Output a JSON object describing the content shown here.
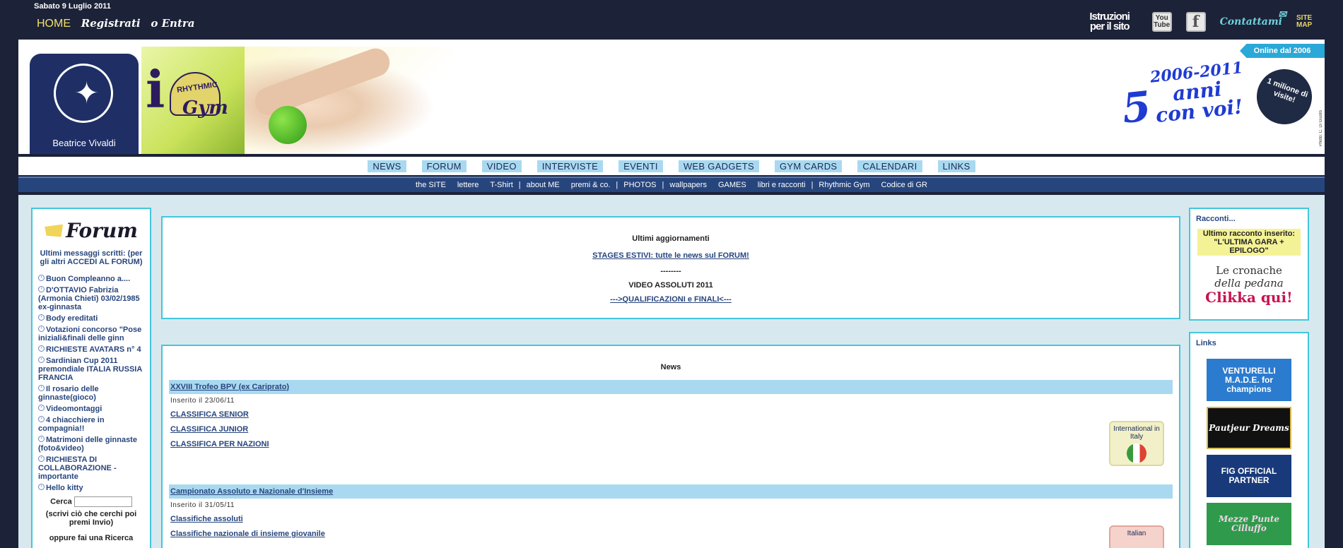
{
  "topbar": {
    "date": "Sabato 9 Luglio 2011",
    "home": "HOME",
    "register": "Registrati",
    "or_enter": "o Entra",
    "instructions": "Istruzioni per il sito",
    "youtube": "You Tube",
    "facebook": "f",
    "contact": "Contattami",
    "sitemap": "SITE MAP"
  },
  "banner": {
    "name": "Beatrice Vivaldi",
    "brand_rhythmic": "RHYTHMIC",
    "brand_gym": "Gym",
    "online_since": "Online dal 2006",
    "years": "2006-2011",
    "five": "5",
    "anni": "anni",
    "con_voi": "con voi!",
    "visits": "1 milione di visite!",
    "photo_credit": "Photo: C. Di Giusto"
  },
  "menu_main": [
    "NEWS",
    "FORUM",
    "VIDEO",
    "INTERVISTE",
    "EVENTI",
    "WEB GADGETS",
    "GYM CARDS",
    "CALENDARI",
    "LINKS"
  ],
  "menu_sub": [
    "the SITE",
    "lettere",
    "T-Shirt",
    "about ME",
    "premi & co.",
    "PHOTOS",
    "wallpapers",
    "GAMES",
    "libri e racconti",
    "Rhythmic Gym",
    "Codice di GR"
  ],
  "forum": {
    "title": "Forum",
    "subtitle": "Ultimi messaggi scritti: (per gli altri ACCEDI AL FORUM)",
    "items": [
      "Buon Compleanno a....",
      "D'OTTAVIO Fabrizia (Armonia Chieti) 03/02/1985 ex-ginnasta",
      "Body ereditati",
      "Votazioni concorso \"Pose iniziali&finali delle ginn",
      "RICHIESTE AVATARS n° 4",
      "Sardinian Cup 2011 premondiale ITALIA RUSSIA FRANCIA",
      "Il rosario delle ginnaste(gioco)",
      "Videomontaggi",
      "4 chiacchiere in compagnia!!",
      "Matrimoni delle ginnaste (foto&video)",
      "RICHIESTA DI COLLABORAZIONE - importante",
      "Hello kitty"
    ],
    "search_label": "Cerca",
    "search_value": "",
    "search_note": "(scrivi ciò che cerchi poi premi Invio)",
    "extra": "oppure fai una Ricerca"
  },
  "updates": {
    "title": "Ultimi aggiornamenti",
    "link1": "STAGES ESTIVI: tutte le news sul FORUM!",
    "dashes": "--------",
    "video_title": "VIDEO ASSOLUTI 2011",
    "link2": "--->QUALIFICAZIONI e FINALI<---"
  },
  "news": {
    "title": "News",
    "items": [
      {
        "headline": "XXVIII Trofeo BPV (ex Cariprato)",
        "meta": "Inserito il 23/06/11",
        "links": [
          "CLASSIFICA SENIOR",
          "CLASSIFICA JUNIOR",
          "CLASSIFICA PER NAZIONI"
        ],
        "badge": "International in Italy"
      },
      {
        "headline": "Campionato Assoluto e Nazionale d'Insieme",
        "meta": "Inserito il 31/05/11",
        "links": [
          "Classifiche assoluti",
          "Classifiche nazionale di insieme giovanile"
        ],
        "badge": "Italian"
      }
    ]
  },
  "racconti": {
    "title": "Racconti...",
    "highlight": "Ultimo racconto inserito: \"L'ULTIMA GARA + EPILOGO\"",
    "line1": "Le cronache",
    "line2": "della pedana",
    "cta": "Clikka qui!"
  },
  "links": {
    "title": "Links",
    "banners": [
      "VENTURELLI M.A.D.E. for champions",
      "Pautjeur Dreams",
      "FIG OFFICIAL PARTNER",
      "Mezze Punte Cilluffo"
    ]
  }
}
